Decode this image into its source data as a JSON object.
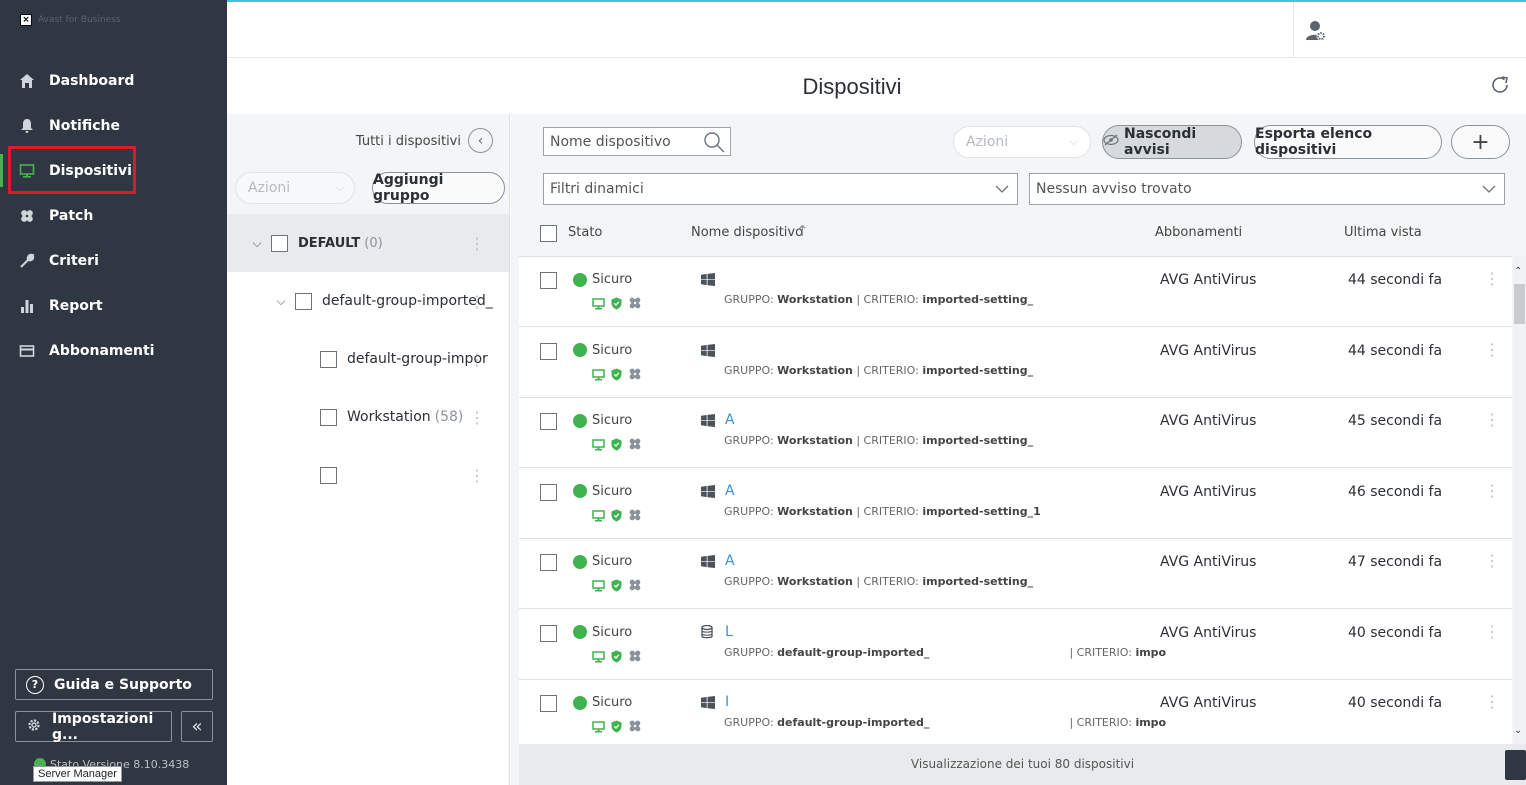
{
  "app": {
    "window_title": "Avast for Business"
  },
  "sidebar": {
    "items": [
      {
        "label": "Dashboard",
        "icon": "home-icon"
      },
      {
        "label": "Notifiche",
        "icon": "bell-icon"
      },
      {
        "label": "Dispositivi",
        "icon": "monitor-icon",
        "active": true
      },
      {
        "label": "Patch",
        "icon": "patch-icon"
      },
      {
        "label": "Criteri",
        "icon": "wrench-icon"
      },
      {
        "label": "Report",
        "icon": "bar-chart-icon"
      },
      {
        "label": "Abbonamenti",
        "icon": "card-icon"
      }
    ],
    "help_label": "Guida e Supporto",
    "settings_label": "Impostazioni g...",
    "version_text": "Stato     Versione 8.10.3438",
    "tooltip": "Server Manager"
  },
  "header": {
    "page_title": "Dispositivi"
  },
  "groups": {
    "all_devices_label": "Tutti i dispositivi",
    "actions_label": "Azioni",
    "add_group_label": "Aggiungi gruppo",
    "tree": [
      {
        "name": "DEFAULT",
        "count": "(0)"
      },
      {
        "name": "default-group-imported_",
        "count": ""
      },
      {
        "name": "default-group-impor",
        "count": ""
      },
      {
        "name": "Workstation",
        "count": "(58)"
      },
      {
        "name": "",
        "count": ""
      }
    ]
  },
  "toolbar": {
    "search_placeholder": "Nome dispositivo",
    "actions_label": "Azioni",
    "hide_alerts_label": "Nascondi avvisi",
    "export_label": "Esporta elenco dispositivi",
    "add_label": "+",
    "dynamic_filters": "Filtri dinamici",
    "alerts_filter": "Nessun avviso trovato"
  },
  "table": {
    "columns": {
      "status": "Stato",
      "name": "Nome dispositivo",
      "subscriptions": "Abbonamenti",
      "last_seen": "Ultima vista"
    },
    "rows": [
      {
        "status": "Sicuro",
        "os": "windows",
        "name": "",
        "group_label": "GRUPPO:",
        "group": "Workstation",
        "policy_label": "CRITERIO:",
        "policy": "imported-setting_",
        "subscription": "AVG AntiVirus",
        "last_seen": "44 secondi fa"
      },
      {
        "status": "Sicuro",
        "os": "windows",
        "name": "",
        "group_label": "GRUPPO:",
        "group": "Workstation",
        "policy_label": "CRITERIO:",
        "policy": "imported-setting_",
        "subscription": "AVG AntiVirus",
        "last_seen": "44 secondi fa"
      },
      {
        "status": "Sicuro",
        "os": "windows",
        "name": "A",
        "group_label": "GRUPPO:",
        "group": "Workstation",
        "policy_label": "CRITERIO:",
        "policy": "imported-setting_",
        "subscription": "AVG AntiVirus",
        "last_seen": "45 secondi fa"
      },
      {
        "status": "Sicuro",
        "os": "windows",
        "name": "A",
        "group_label": "GRUPPO:",
        "group": "Workstation",
        "policy_label": "CRITERIO:",
        "policy": "imported-setting_1",
        "subscription": "AVG AntiVirus",
        "last_seen": "46 secondi fa"
      },
      {
        "status": "Sicuro",
        "os": "windows",
        "name": "A",
        "group_label": "GRUPPO:",
        "group": "Workstation",
        "policy_label": "CRITERIO:",
        "policy": "imported-setting_",
        "subscription": "AVG AntiVirus",
        "last_seen": "47 secondi fa"
      },
      {
        "status": "Sicuro",
        "os": "server",
        "name": "L",
        "group_label": "GRUPPO:",
        "group": "default-group-imported_",
        "policy_label": "| CRITERIO:",
        "policy": "impo",
        "subscription": "AVG AntiVirus",
        "last_seen": "40 secondi fa"
      },
      {
        "status": "Sicuro",
        "os": "windows",
        "name": "I",
        "group_label": "GRUPPO:",
        "group": "default-group-imported_",
        "policy_label": "| CRITERIO:",
        "policy": "impo",
        "subscription": "AVG AntiVirus",
        "last_seen": "40 secondi fa"
      }
    ],
    "footer": "Visualizzazione dei tuoi 80 dispositivi"
  },
  "colors": {
    "sidebar_bg": "#2f3742",
    "status_green": "#3fb34f",
    "highlight_red": "#e0182d",
    "link_blue": "#3b8fd6"
  }
}
